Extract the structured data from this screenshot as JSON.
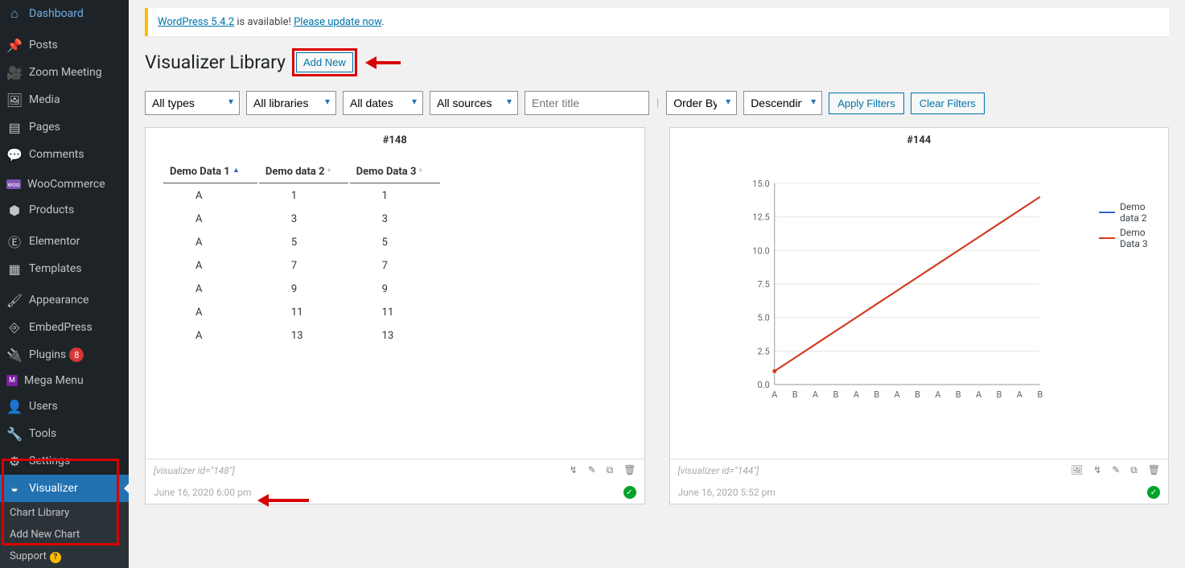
{
  "sidebar": {
    "items": [
      {
        "label": "Dashboard"
      },
      {
        "label": "Posts"
      },
      {
        "label": "Zoom Meeting"
      },
      {
        "label": "Media"
      },
      {
        "label": "Pages"
      },
      {
        "label": "Comments"
      },
      {
        "label": "WooCommerce"
      },
      {
        "label": "Products"
      },
      {
        "label": "Elementor"
      },
      {
        "label": "Templates"
      },
      {
        "label": "Appearance"
      },
      {
        "label": "EmbedPress"
      },
      {
        "label": "Plugins",
        "badge": "8"
      },
      {
        "label": "Mega Menu"
      },
      {
        "label": "Users"
      },
      {
        "label": "Tools"
      },
      {
        "label": "Settings"
      },
      {
        "label": "Visualizer",
        "active": true
      }
    ],
    "submenu": [
      {
        "label": "Chart Library"
      },
      {
        "label": "Add New Chart"
      },
      {
        "label": "Support"
      }
    ]
  },
  "notice": {
    "link1": "WordPress 5.4.2",
    "mid": " is available! ",
    "link2": "Please update now",
    "period": "."
  },
  "header": {
    "title": "Visualizer Library",
    "add_new": "Add New"
  },
  "filters": {
    "types": "All types",
    "libraries": "All libraries",
    "dates": "All dates",
    "sources": "All sources",
    "title_placeholder": "Enter title",
    "orderby": "Order By",
    "direction": "Descending",
    "apply": "Apply Filters",
    "clear": "Clear Filters"
  },
  "cards": [
    {
      "title": "#148",
      "shortcode": "[visualizer id=\"148\"]",
      "timestamp": "June 16, 2020 6:00 pm"
    },
    {
      "title": "#144",
      "shortcode": "[visualizer id=\"144\"]",
      "timestamp": "June 16, 2020 5:52 pm"
    }
  ],
  "chart_data": [
    {
      "type": "table",
      "columns": [
        "Demo Data 1",
        "Demo data 2",
        "Demo Data 3"
      ],
      "rows": [
        [
          "A",
          "1",
          "1"
        ],
        [
          "A",
          "3",
          "3"
        ],
        [
          "A",
          "5",
          "5"
        ],
        [
          "A",
          "7",
          "7"
        ],
        [
          "A",
          "9",
          "9"
        ],
        [
          "A",
          "11",
          "11"
        ],
        [
          "A",
          "13",
          "13"
        ]
      ]
    },
    {
      "type": "line",
      "series": [
        {
          "name": "Demo data 2",
          "color": "#3366cc",
          "values": [
            1,
            2,
            3,
            4,
            5,
            6,
            7,
            8,
            9,
            10,
            11,
            12,
            13,
            14
          ]
        },
        {
          "name": "Demo Data 3",
          "color": "#dc3912",
          "values": [
            1,
            2,
            3,
            4,
            5,
            6,
            7,
            8,
            9,
            10,
            11,
            12,
            13,
            14
          ]
        }
      ],
      "categories": [
        "A",
        "B",
        "A",
        "B",
        "A",
        "B",
        "A",
        "B",
        "A",
        "B",
        "A",
        "B",
        "A",
        "B"
      ],
      "ylim": [
        0,
        15
      ],
      "yticks": [
        0.0,
        2.5,
        5.0,
        7.5,
        10.0,
        12.5,
        15.0
      ]
    }
  ]
}
